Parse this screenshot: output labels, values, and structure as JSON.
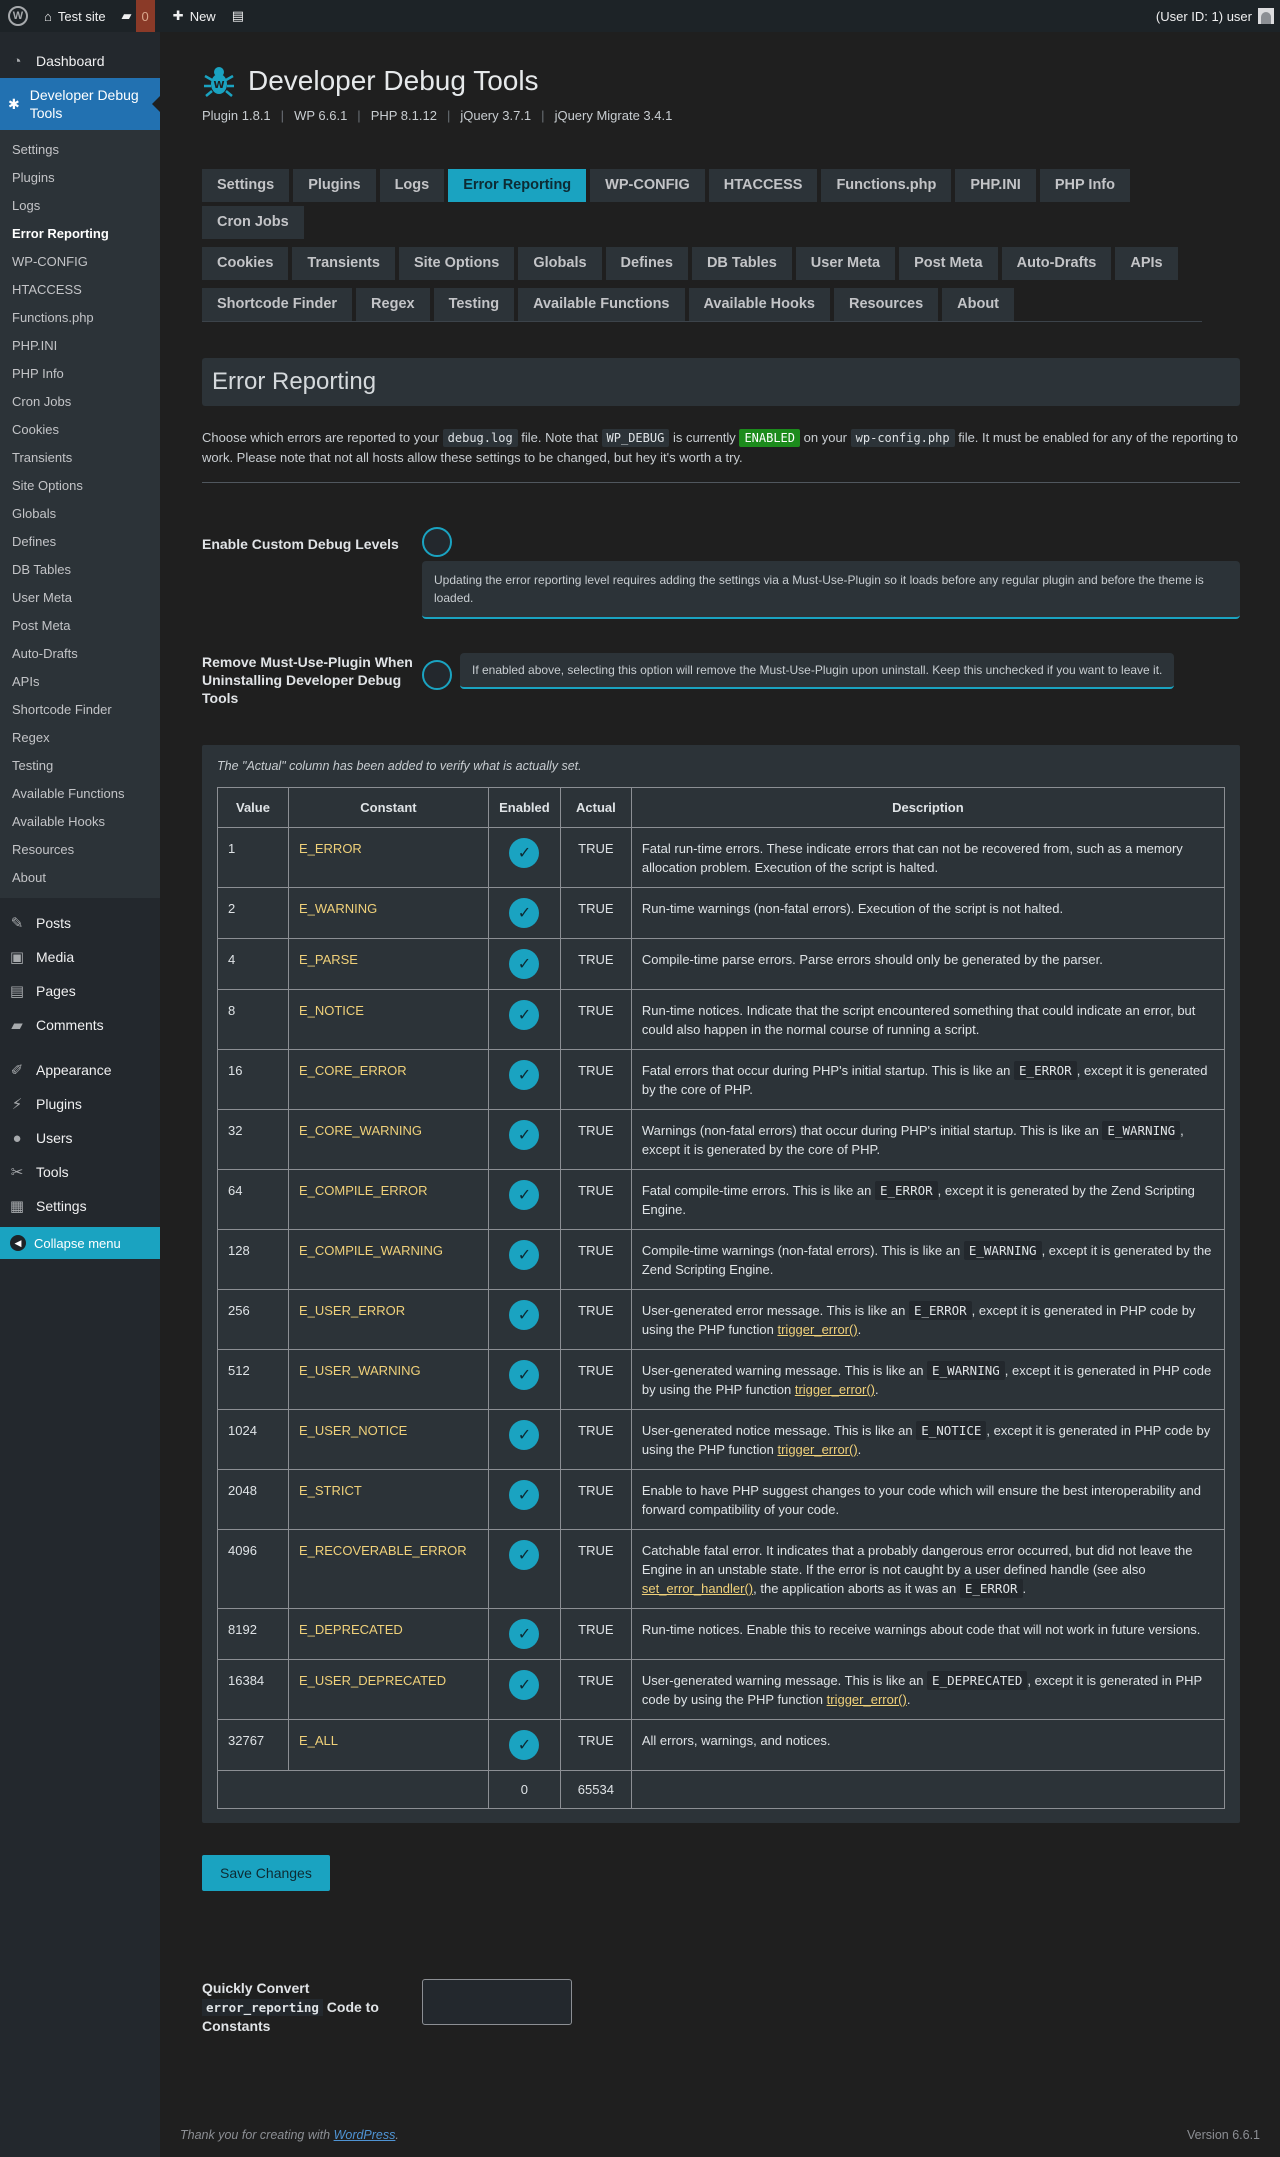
{
  "adminbar": {
    "site_name": "Test site",
    "comments_count": "0",
    "new_label": "New",
    "user_label": "(User ID: 1) user"
  },
  "sidebar": {
    "dashboard": "Dashboard",
    "plugin_menu": "Developer Debug Tools",
    "submenu": [
      "Settings",
      "Plugins",
      "Logs",
      "Error Reporting",
      "WP-CONFIG",
      "HTACCESS",
      "Functions.php",
      "PHP.INI",
      "PHP Info",
      "Cron Jobs",
      "Cookies",
      "Transients",
      "Site Options",
      "Globals",
      "Defines",
      "DB Tables",
      "User Meta",
      "Post Meta",
      "Auto-Drafts",
      "APIs",
      "Shortcode Finder",
      "Regex",
      "Testing",
      "Available Functions",
      "Available Hooks",
      "Resources",
      "About"
    ],
    "menu": [
      "Posts",
      "Media",
      "Pages",
      "Comments",
      "Appearance",
      "Plugins",
      "Users",
      "Tools",
      "Settings"
    ],
    "collapse": "Collapse menu"
  },
  "header": {
    "title": "Developer Debug Tools",
    "versions": [
      "Plugin 1.8.1",
      "WP 6.6.1",
      "PHP 8.1.12",
      "jQuery 3.7.1",
      "jQuery Migrate 3.4.1"
    ]
  },
  "tabs": [
    "Settings",
    "Plugins",
    "Logs",
    "Error Reporting",
    "WP-CONFIG",
    "HTACCESS",
    "Functions.php",
    "PHP.INI",
    "PHP Info",
    "Cron Jobs",
    "Cookies",
    "Transients",
    "Site Options",
    "Globals",
    "Defines",
    "DB Tables",
    "User Meta",
    "Post Meta",
    "Auto-Drafts",
    "APIs",
    "Shortcode Finder",
    "Regex",
    "Testing",
    "Available Functions",
    "Available Hooks",
    "Resources",
    "About"
  ],
  "active_tab": "Error Reporting",
  "section": {
    "title": "Error Reporting",
    "intro_1": "Choose which errors are reported to your",
    "intro_code_1": "debug.log",
    "intro_2": "file. Note that",
    "intro_code_2": "WP_DEBUG",
    "intro_3": "is currently",
    "intro_enabled": "ENABLED",
    "intro_4": "on your",
    "intro_code_3": "wp-config.php",
    "intro_5": "file. It must be enabled for any of the reporting to work. Please note that not all hosts allow these settings to be changed, but hey it's worth a try."
  },
  "options": {
    "custom_levels_label": "Enable Custom Debug Levels",
    "custom_levels_note": "Updating the error reporting level requires adding the settings via a Must-Use-Plugin so it loads before any regular plugin and before the theme is loaded.",
    "remove_mu_label": "Remove Must-Use-Plugin When Uninstalling Developer Debug Tools",
    "remove_mu_note": "If enabled above, selecting this option will remove the Must-Use-Plugin upon uninstall. Keep this unchecked if you want to leave it."
  },
  "table": {
    "caption": "The \"Actual\" column has been added to verify what is actually set.",
    "headers": [
      "Value",
      "Constant",
      "Enabled",
      "Actual",
      "Description"
    ],
    "check_glyph": "✓",
    "rows": [
      {
        "value": "1",
        "constant": "E_ERROR",
        "actual": "TRUE",
        "d": [
          "Fatal run-time errors. These indicate errors that can not be recovered from, such as a memory allocation problem. Execution of the script is halted."
        ]
      },
      {
        "value": "2",
        "constant": "E_WARNING",
        "actual": "TRUE",
        "d": [
          "Run-time warnings (non-fatal errors). Execution of the script is not halted."
        ]
      },
      {
        "value": "4",
        "constant": "E_PARSE",
        "actual": "TRUE",
        "d": [
          "Compile-time parse errors. Parse errors should only be generated by the parser."
        ]
      },
      {
        "value": "8",
        "constant": "E_NOTICE",
        "actual": "TRUE",
        "d": [
          "Run-time notices. Indicate that the script encountered something that could indicate an error, but could also happen in the normal course of running a script."
        ]
      },
      {
        "value": "16",
        "constant": "E_CORE_ERROR",
        "actual": "TRUE",
        "d": [
          "Fatal errors that occur during PHP's initial startup. This is like an ",
          "E_ERROR",
          ", except it is generated by the core of PHP."
        ]
      },
      {
        "value": "32",
        "constant": "E_CORE_WARNING",
        "actual": "TRUE",
        "d": [
          "Warnings (non-fatal errors) that occur during PHP's initial startup. This is like an ",
          "E_WARNING",
          ", except it is generated by the core of PHP."
        ]
      },
      {
        "value": "64",
        "constant": "E_COMPILE_ERROR",
        "actual": "TRUE",
        "d": [
          "Fatal compile-time errors. This is like an ",
          "E_ERROR",
          ", except it is generated by the Zend Scripting Engine."
        ]
      },
      {
        "value": "128",
        "constant": "E_COMPILE_WARNING",
        "actual": "TRUE",
        "d": [
          "Compile-time warnings (non-fatal errors). This is like an ",
          "E_WARNING",
          ", except it is generated by the Zend Scripting Engine."
        ]
      },
      {
        "value": "256",
        "constant": "E_USER_ERROR",
        "actual": "TRUE",
        "d": [
          "User-generated error message. This is like an ",
          "E_ERROR",
          ", except it is generated in PHP code by using the PHP function ",
          "trigger_error()",
          "."
        ]
      },
      {
        "value": "512",
        "constant": "E_USER_WARNING",
        "actual": "TRUE",
        "d": [
          "User-generated warning message. This is like an ",
          "E_WARNING",
          ", except it is generated in PHP code by using the PHP function ",
          "trigger_error()",
          "."
        ]
      },
      {
        "value": "1024",
        "constant": "E_USER_NOTICE",
        "actual": "TRUE",
        "d": [
          "User-generated notice message. This is like an ",
          "E_NOTICE",
          ", except it is generated in PHP code by using the PHP function ",
          "trigger_error()",
          "."
        ]
      },
      {
        "value": "2048",
        "constant": "E_STRICT",
        "actual": "TRUE",
        "d": [
          "Enable to have PHP suggest changes to your code which will ensure the best interoperability and forward compatibility of your code."
        ]
      },
      {
        "value": "4096",
        "constant": "E_RECOVERABLE_ERROR",
        "actual": "TRUE",
        "d": [
          "Catchable fatal error. It indicates that a probably dangerous error occurred, but did not leave the Engine in an unstable state. If the error is not caught by a user defined handle (see also ",
          "set_error_handler()",
          ", the application aborts as it was an ",
          "E_ERROR",
          "."
        ]
      },
      {
        "value": "8192",
        "constant": "E_DEPRECATED",
        "actual": "TRUE",
        "d": [
          "Run-time notices. Enable this to receive warnings about code that will not work in future versions."
        ]
      },
      {
        "value": "16384",
        "constant": "E_USER_DEPRECATED",
        "actual": "TRUE",
        "d": [
          "User-generated warning message. This is like an ",
          "E_DEPRECATED",
          ", except it is generated in PHP code by using the PHP function ",
          "trigger_error()",
          "."
        ]
      },
      {
        "value": "32767",
        "constant": "E_ALL",
        "actual": "TRUE",
        "d": [
          "All errors, warnings, and notices."
        ]
      }
    ],
    "total_enabled": "0",
    "total_actual": "65534"
  },
  "save_label": "Save Changes",
  "convert": {
    "label_1": "Quickly Convert",
    "label_code": "error_reporting",
    "label_2": "Code to Constants",
    "value": ""
  },
  "footer": {
    "thanks_1": "Thank you for creating with",
    "thanks_link": "WordPress",
    "thanks_2": ".",
    "version": "Version 6.6.1"
  }
}
